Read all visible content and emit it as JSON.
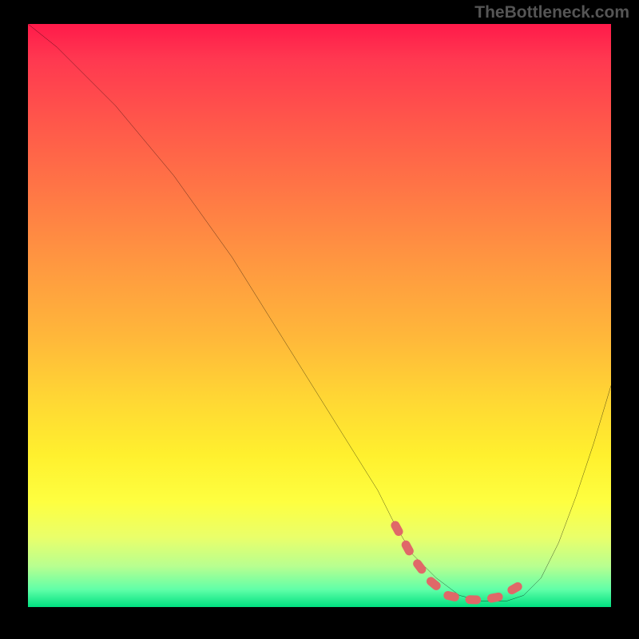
{
  "watermark": "TheBottleneck.com",
  "chart_data": {
    "type": "line",
    "title": "",
    "xlabel": "",
    "ylabel": "",
    "xlim": [
      0,
      100
    ],
    "ylim": [
      0,
      100
    ],
    "gradient_colors": {
      "top": "#ff1a4a",
      "mid_upper": "#ff9a40",
      "mid_lower": "#feff40",
      "bottom": "#00e080"
    },
    "series": [
      {
        "name": "bottleneck-curve",
        "color": "#000000",
        "stroke_width": 2,
        "x": [
          0,
          5,
          10,
          15,
          20,
          25,
          30,
          35,
          40,
          45,
          50,
          55,
          60,
          63,
          66,
          70,
          74,
          78,
          82,
          85,
          88,
          91,
          94,
          97,
          100
        ],
        "values": [
          100,
          96,
          91,
          86,
          80,
          74,
          67,
          60,
          52,
          44,
          36,
          28,
          20,
          14,
          9,
          5,
          2,
          1,
          1,
          2,
          5,
          11,
          19,
          28,
          38
        ]
      },
      {
        "name": "optimal-range-markers",
        "color": "#e06868",
        "type": "scatter",
        "marker_size": 9,
        "x": [
          63,
          66,
          69,
          72,
          75,
          78,
          81,
          84
        ],
        "values": [
          14,
          8.5,
          4.5,
          2.0,
          1.3,
          1.2,
          1.8,
          3.5
        ]
      }
    ],
    "annotations": []
  }
}
